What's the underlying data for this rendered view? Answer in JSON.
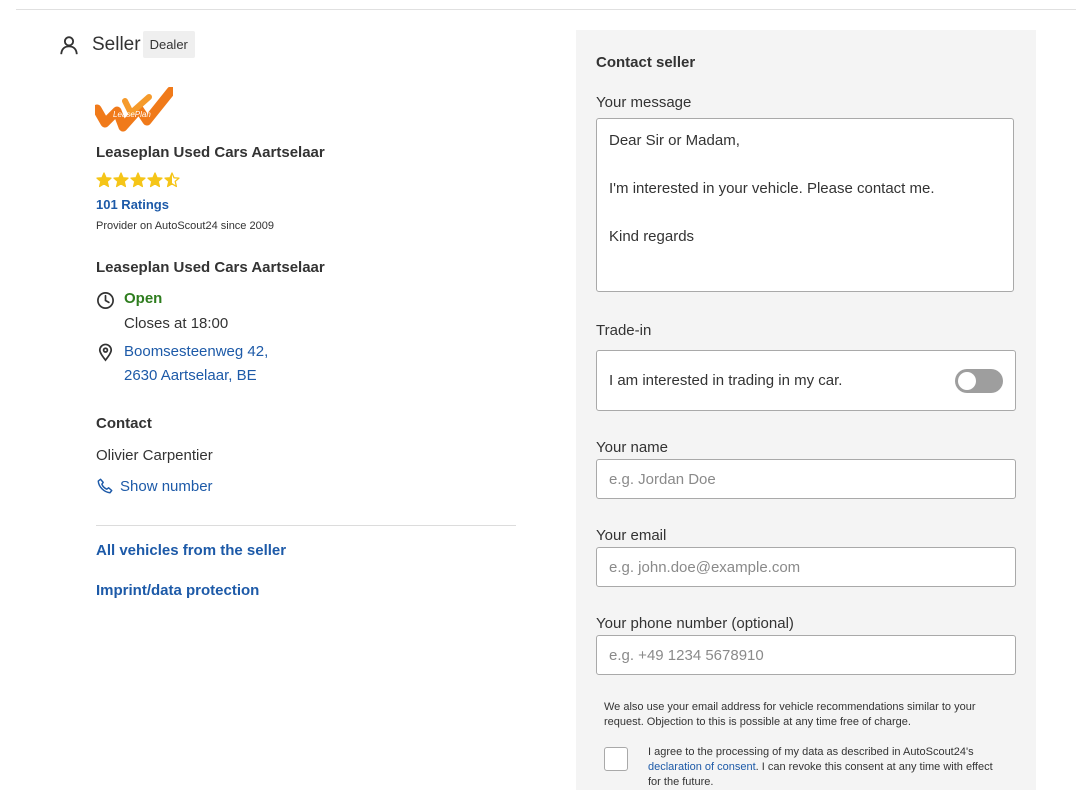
{
  "seller": {
    "title": "Seller",
    "badge": "Dealer",
    "logo_text": "LeasePlan",
    "dealer_name": "Leaseplan Used Cars Aartselaar",
    "rating": 4.5,
    "ratings_count": "101 Ratings",
    "provider_since": "Provider on AutoScout24 since 2009",
    "location_name": "Leaseplan Used Cars Aartselaar",
    "status": "Open",
    "closes": "Closes at 18:00",
    "address_line1": "Boomsesteenweg 42,",
    "address_line2": "2630 Aartselaar, BE",
    "contact_heading": "Contact",
    "contact_person": "Olivier Carpentier",
    "show_number": "Show number",
    "all_vehicles": "All vehicles from the seller",
    "imprint": "Imprint/data protection"
  },
  "form": {
    "title": "Contact seller",
    "message_label": "Your message",
    "message_value": "Dear Sir or Madam,\n\nI'm interested in your vehicle. Please contact me.\n\nKind regards",
    "tradein_label": "Trade-in",
    "tradein_text": "I am interested in trading in my car.",
    "tradein_enabled": false,
    "name_label": "Your name",
    "name_placeholder": "e.g. Jordan Doe",
    "email_label": "Your email",
    "email_placeholder": "e.g. john.doe@example.com",
    "phone_label": "Your phone number (optional)",
    "phone_placeholder": "e.g. +49 1234 5678910",
    "notice": "We also use your email address for vehicle recommendations similar to your request. Objection to this is possible at any time free of charge.",
    "consent_before": "I agree to the processing of my data as described in AutoScout24's ",
    "consent_link": "declaration of consent",
    "consent_after": ". I can revoke this consent at any time with effect for the future."
  },
  "colors": {
    "link": "#1d5aa8",
    "open": "#2e7d1e",
    "star": "#f5c518",
    "panel_bg": "#f4f4f4"
  }
}
